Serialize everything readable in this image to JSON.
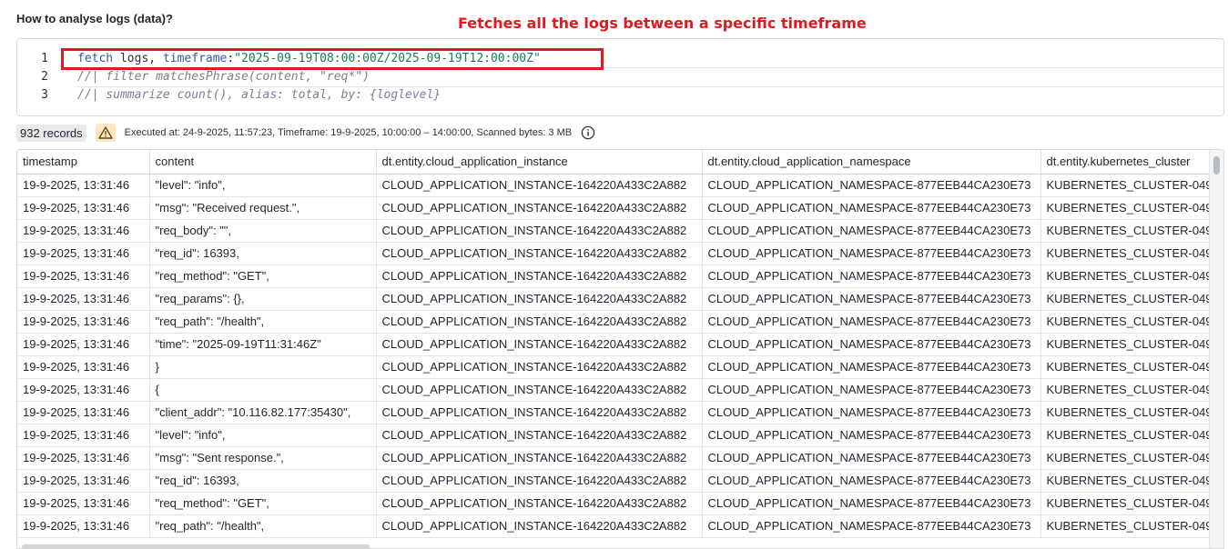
{
  "section": {
    "title": "How to analyse logs (data)?"
  },
  "annotation": {
    "text": "Fetches all the logs between a specific timeframe",
    "color": "#e0191f"
  },
  "editor": {
    "lines": [
      {
        "num": "1",
        "parts": [
          {
            "cls": "kw",
            "text": "fetch"
          },
          {
            "cls": "ident",
            "text": " logs, "
          },
          {
            "cls": "kw",
            "text": "timeframe"
          },
          {
            "cls": "ident",
            "text": ":"
          },
          {
            "cls": "str",
            "text": "\"2025-09-19T08:00:00Z/2025-09-19T12:00:00Z\""
          }
        ]
      },
      {
        "num": "2",
        "parts": [
          {
            "cls": "cmt",
            "text": "//| filter matchesPhrase(content, \"req*\")"
          }
        ]
      },
      {
        "num": "3",
        "parts": [
          {
            "cls": "cmt",
            "text": "//| summarize count(), alias: total, by: {loglevel}"
          }
        ]
      }
    ]
  },
  "status": {
    "records": "932 records",
    "warning_icon": "warning-triangle-icon",
    "executed": "Executed at: 24-9-2025, 11:57:23, Timeframe: 19-9-2025, 10:00:00 – 14:00:00, Scanned bytes: 3 MB",
    "info_icon": "info-circle-icon"
  },
  "table": {
    "columns": [
      "timestamp",
      "content",
      "dt.entity.cloud_application_instance",
      "dt.entity.cloud_application_namespace",
      "dt.entity.kubernetes_cluster"
    ],
    "rows": [
      [
        "19-9-2025, 13:31:46",
        "\"level\": \"info\",",
        "CLOUD_APPLICATION_INSTANCE-164220A433C2A882",
        "CLOUD_APPLICATION_NAMESPACE-877EEB44CA230E73",
        "KUBERNETES_CLUSTER-049"
      ],
      [
        "19-9-2025, 13:31:46",
        "\"msg\": \"Received request.\",",
        "CLOUD_APPLICATION_INSTANCE-164220A433C2A882",
        "CLOUD_APPLICATION_NAMESPACE-877EEB44CA230E73",
        "KUBERNETES_CLUSTER-049"
      ],
      [
        "19-9-2025, 13:31:46",
        "\"req_body\": \"\",",
        "CLOUD_APPLICATION_INSTANCE-164220A433C2A882",
        "CLOUD_APPLICATION_NAMESPACE-877EEB44CA230E73",
        "KUBERNETES_CLUSTER-049"
      ],
      [
        "19-9-2025, 13:31:46",
        "\"req_id\": 16393,",
        "CLOUD_APPLICATION_INSTANCE-164220A433C2A882",
        "CLOUD_APPLICATION_NAMESPACE-877EEB44CA230E73",
        "KUBERNETES_CLUSTER-049"
      ],
      [
        "19-9-2025, 13:31:46",
        "\"req_method\": \"GET\",",
        "CLOUD_APPLICATION_INSTANCE-164220A433C2A882",
        "CLOUD_APPLICATION_NAMESPACE-877EEB44CA230E73",
        "KUBERNETES_CLUSTER-049"
      ],
      [
        "19-9-2025, 13:31:46",
        "\"req_params\": {},",
        "CLOUD_APPLICATION_INSTANCE-164220A433C2A882",
        "CLOUD_APPLICATION_NAMESPACE-877EEB44CA230E73",
        "KUBERNETES_CLUSTER-049"
      ],
      [
        "19-9-2025, 13:31:46",
        "\"req_path\": \"/health\",",
        "CLOUD_APPLICATION_INSTANCE-164220A433C2A882",
        "CLOUD_APPLICATION_NAMESPACE-877EEB44CA230E73",
        "KUBERNETES_CLUSTER-049"
      ],
      [
        "19-9-2025, 13:31:46",
        "\"time\": \"2025-09-19T11:31:46Z\"",
        "CLOUD_APPLICATION_INSTANCE-164220A433C2A882",
        "CLOUD_APPLICATION_NAMESPACE-877EEB44CA230E73",
        "KUBERNETES_CLUSTER-049"
      ],
      [
        "19-9-2025, 13:31:46",
        "}",
        "CLOUD_APPLICATION_INSTANCE-164220A433C2A882",
        "CLOUD_APPLICATION_NAMESPACE-877EEB44CA230E73",
        "KUBERNETES_CLUSTER-049"
      ],
      [
        "19-9-2025, 13:31:46",
        "{",
        "CLOUD_APPLICATION_INSTANCE-164220A433C2A882",
        "CLOUD_APPLICATION_NAMESPACE-877EEB44CA230E73",
        "KUBERNETES_CLUSTER-049"
      ],
      [
        "19-9-2025, 13:31:46",
        "\"client_addr\": \"10.116.82.177:35430\",",
        "CLOUD_APPLICATION_INSTANCE-164220A433C2A882",
        "CLOUD_APPLICATION_NAMESPACE-877EEB44CA230E73",
        "KUBERNETES_CLUSTER-049"
      ],
      [
        "19-9-2025, 13:31:46",
        "\"level\": \"info\",",
        "CLOUD_APPLICATION_INSTANCE-164220A433C2A882",
        "CLOUD_APPLICATION_NAMESPACE-877EEB44CA230E73",
        "KUBERNETES_CLUSTER-049"
      ],
      [
        "19-9-2025, 13:31:46",
        "\"msg\": \"Sent response.\",",
        "CLOUD_APPLICATION_INSTANCE-164220A433C2A882",
        "CLOUD_APPLICATION_NAMESPACE-877EEB44CA230E73",
        "KUBERNETES_CLUSTER-049"
      ],
      [
        "19-9-2025, 13:31:46",
        "\"req_id\": 16393,",
        "CLOUD_APPLICATION_INSTANCE-164220A433C2A882",
        "CLOUD_APPLICATION_NAMESPACE-877EEB44CA230E73",
        "KUBERNETES_CLUSTER-049"
      ],
      [
        "19-9-2025, 13:31:46",
        "\"req_method\": \"GET\",",
        "CLOUD_APPLICATION_INSTANCE-164220A433C2A882",
        "CLOUD_APPLICATION_NAMESPACE-877EEB44CA230E73",
        "KUBERNETES_CLUSTER-049"
      ],
      [
        "19-9-2025, 13:31:46",
        "\"req_path\": \"/health\",",
        "CLOUD_APPLICATION_INSTANCE-164220A433C2A882",
        "CLOUD_APPLICATION_NAMESPACE-877EEB44CA230E73",
        "KUBERNETES_CLUSTER-049"
      ]
    ]
  }
}
